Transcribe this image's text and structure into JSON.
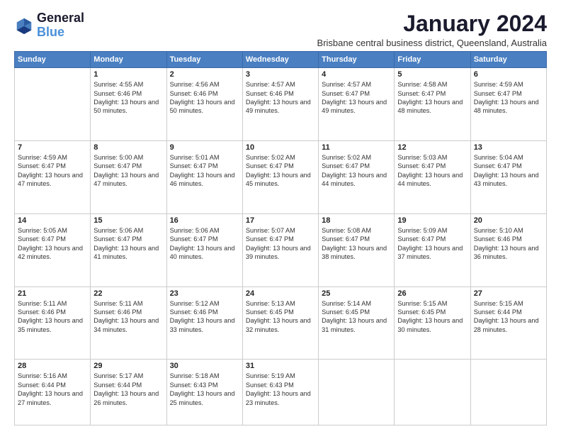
{
  "app": {
    "logo_line1": "General",
    "logo_line2": "Blue"
  },
  "header": {
    "title": "January 2024",
    "subtitle": "Brisbane central business district, Queensland, Australia"
  },
  "columns": [
    "Sunday",
    "Monday",
    "Tuesday",
    "Wednesday",
    "Thursday",
    "Friday",
    "Saturday"
  ],
  "weeks": [
    [
      {
        "day": "",
        "sunrise": "",
        "sunset": "",
        "daylight": ""
      },
      {
        "day": "1",
        "sunrise": "Sunrise: 4:55 AM",
        "sunset": "Sunset: 6:46 PM",
        "daylight": "Daylight: 13 hours and 50 minutes."
      },
      {
        "day": "2",
        "sunrise": "Sunrise: 4:56 AM",
        "sunset": "Sunset: 6:46 PM",
        "daylight": "Daylight: 13 hours and 50 minutes."
      },
      {
        "day": "3",
        "sunrise": "Sunrise: 4:57 AM",
        "sunset": "Sunset: 6:46 PM",
        "daylight": "Daylight: 13 hours and 49 minutes."
      },
      {
        "day": "4",
        "sunrise": "Sunrise: 4:57 AM",
        "sunset": "Sunset: 6:47 PM",
        "daylight": "Daylight: 13 hours and 49 minutes."
      },
      {
        "day": "5",
        "sunrise": "Sunrise: 4:58 AM",
        "sunset": "Sunset: 6:47 PM",
        "daylight": "Daylight: 13 hours and 48 minutes."
      },
      {
        "day": "6",
        "sunrise": "Sunrise: 4:59 AM",
        "sunset": "Sunset: 6:47 PM",
        "daylight": "Daylight: 13 hours and 48 minutes."
      }
    ],
    [
      {
        "day": "7",
        "sunrise": "Sunrise: 4:59 AM",
        "sunset": "Sunset: 6:47 PM",
        "daylight": "Daylight: 13 hours and 47 minutes."
      },
      {
        "day": "8",
        "sunrise": "Sunrise: 5:00 AM",
        "sunset": "Sunset: 6:47 PM",
        "daylight": "Daylight: 13 hours and 47 minutes."
      },
      {
        "day": "9",
        "sunrise": "Sunrise: 5:01 AM",
        "sunset": "Sunset: 6:47 PM",
        "daylight": "Daylight: 13 hours and 46 minutes."
      },
      {
        "day": "10",
        "sunrise": "Sunrise: 5:02 AM",
        "sunset": "Sunset: 6:47 PM",
        "daylight": "Daylight: 13 hours and 45 minutes."
      },
      {
        "day": "11",
        "sunrise": "Sunrise: 5:02 AM",
        "sunset": "Sunset: 6:47 PM",
        "daylight": "Daylight: 13 hours and 44 minutes."
      },
      {
        "day": "12",
        "sunrise": "Sunrise: 5:03 AM",
        "sunset": "Sunset: 6:47 PM",
        "daylight": "Daylight: 13 hours and 44 minutes."
      },
      {
        "day": "13",
        "sunrise": "Sunrise: 5:04 AM",
        "sunset": "Sunset: 6:47 PM",
        "daylight": "Daylight: 13 hours and 43 minutes."
      }
    ],
    [
      {
        "day": "14",
        "sunrise": "Sunrise: 5:05 AM",
        "sunset": "Sunset: 6:47 PM",
        "daylight": "Daylight: 13 hours and 42 minutes."
      },
      {
        "day": "15",
        "sunrise": "Sunrise: 5:06 AM",
        "sunset": "Sunset: 6:47 PM",
        "daylight": "Daylight: 13 hours and 41 minutes."
      },
      {
        "day": "16",
        "sunrise": "Sunrise: 5:06 AM",
        "sunset": "Sunset: 6:47 PM",
        "daylight": "Daylight: 13 hours and 40 minutes."
      },
      {
        "day": "17",
        "sunrise": "Sunrise: 5:07 AM",
        "sunset": "Sunset: 6:47 PM",
        "daylight": "Daylight: 13 hours and 39 minutes."
      },
      {
        "day": "18",
        "sunrise": "Sunrise: 5:08 AM",
        "sunset": "Sunset: 6:47 PM",
        "daylight": "Daylight: 13 hours and 38 minutes."
      },
      {
        "day": "19",
        "sunrise": "Sunrise: 5:09 AM",
        "sunset": "Sunset: 6:47 PM",
        "daylight": "Daylight: 13 hours and 37 minutes."
      },
      {
        "day": "20",
        "sunrise": "Sunrise: 5:10 AM",
        "sunset": "Sunset: 6:46 PM",
        "daylight": "Daylight: 13 hours and 36 minutes."
      }
    ],
    [
      {
        "day": "21",
        "sunrise": "Sunrise: 5:11 AM",
        "sunset": "Sunset: 6:46 PM",
        "daylight": "Daylight: 13 hours and 35 minutes."
      },
      {
        "day": "22",
        "sunrise": "Sunrise: 5:11 AM",
        "sunset": "Sunset: 6:46 PM",
        "daylight": "Daylight: 13 hours and 34 minutes."
      },
      {
        "day": "23",
        "sunrise": "Sunrise: 5:12 AM",
        "sunset": "Sunset: 6:46 PM",
        "daylight": "Daylight: 13 hours and 33 minutes."
      },
      {
        "day": "24",
        "sunrise": "Sunrise: 5:13 AM",
        "sunset": "Sunset: 6:45 PM",
        "daylight": "Daylight: 13 hours and 32 minutes."
      },
      {
        "day": "25",
        "sunrise": "Sunrise: 5:14 AM",
        "sunset": "Sunset: 6:45 PM",
        "daylight": "Daylight: 13 hours and 31 minutes."
      },
      {
        "day": "26",
        "sunrise": "Sunrise: 5:15 AM",
        "sunset": "Sunset: 6:45 PM",
        "daylight": "Daylight: 13 hours and 30 minutes."
      },
      {
        "day": "27",
        "sunrise": "Sunrise: 5:15 AM",
        "sunset": "Sunset: 6:44 PM",
        "daylight": "Daylight: 13 hours and 28 minutes."
      }
    ],
    [
      {
        "day": "28",
        "sunrise": "Sunrise: 5:16 AM",
        "sunset": "Sunset: 6:44 PM",
        "daylight": "Daylight: 13 hours and 27 minutes."
      },
      {
        "day": "29",
        "sunrise": "Sunrise: 5:17 AM",
        "sunset": "Sunset: 6:44 PM",
        "daylight": "Daylight: 13 hours and 26 minutes."
      },
      {
        "day": "30",
        "sunrise": "Sunrise: 5:18 AM",
        "sunset": "Sunset: 6:43 PM",
        "daylight": "Daylight: 13 hours and 25 minutes."
      },
      {
        "day": "31",
        "sunrise": "Sunrise: 5:19 AM",
        "sunset": "Sunset: 6:43 PM",
        "daylight": "Daylight: 13 hours and 23 minutes."
      },
      {
        "day": "",
        "sunrise": "",
        "sunset": "",
        "daylight": ""
      },
      {
        "day": "",
        "sunrise": "",
        "sunset": "",
        "daylight": ""
      },
      {
        "day": "",
        "sunrise": "",
        "sunset": "",
        "daylight": ""
      }
    ]
  ]
}
